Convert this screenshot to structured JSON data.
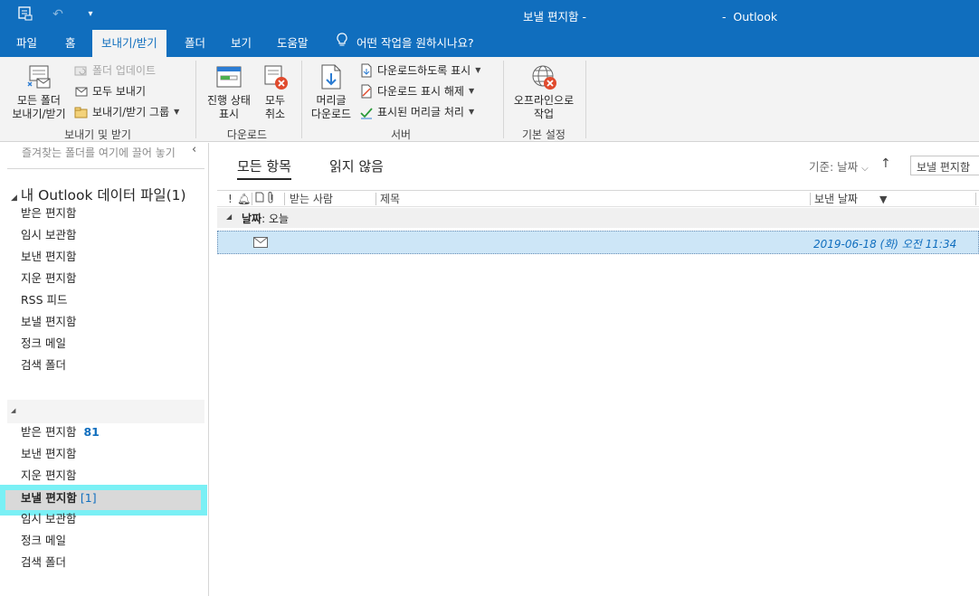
{
  "titlebar": {
    "title": "보낼 편지함 -",
    "app": "-  Outlook",
    "qat_icons": [
      "send-receive-all-icon",
      "undo-icon",
      "customize-qat-icon"
    ]
  },
  "tabs": [
    {
      "label": "파일"
    },
    {
      "label": "홈"
    },
    {
      "label": "보내기/받기",
      "active": true
    },
    {
      "label": "폴더"
    },
    {
      "label": "보기"
    },
    {
      "label": "도움말"
    }
  ],
  "tell_me": "어떤 작업을 원하시나요?",
  "ribbon": {
    "send_receive_all_line1": "모든 폴더",
    "send_receive_all_line2": "보내기/받기",
    "update_folder": "폴더 업데이트",
    "send_all": "모두 보내기",
    "send_receive_groups": "보내기/받기 그룹",
    "group1_label": "보내기 및 받기",
    "show_progress_line1": "진행 상태",
    "show_progress_line2": "표시",
    "cancel_all_line1": "모두",
    "cancel_all_line2": "취소",
    "group2_label": "다운로드",
    "download_headers_line1": "머리글",
    "download_headers_line2": "다운로드",
    "mark_to_download": "다운로드하도록 표시",
    "unmark_to_download": "다운로드 표시 해제",
    "process_marked_headers": "표시된 머리글 처리",
    "group3_label": "서버",
    "work_offline_line1": "오프라인으로",
    "work_offline_line2": "작업",
    "group4_label": "기본 설정"
  },
  "nav": {
    "favorites_hint": "즐겨찾는 폴더를 여기에 끌어 놓기",
    "store_name": "내 Outlook 데이터 파일(1)",
    "store_folders": [
      "받은 편지함",
      "임시 보관함",
      "보낸 편지함",
      "지운 편지함",
      "RSS 피드",
      "보낼 편지함",
      "정크 메일",
      "검색 폴더"
    ],
    "second_store": {
      "inbox": "받은 편지함",
      "inbox_count": "81",
      "sent": "보낸 편지함",
      "deleted": "지운 편지함",
      "outbox": "보낼 편지함",
      "outbox_count": "[1]",
      "drafts": "임시 보관함",
      "junk": "정크 메일",
      "search": "검색 폴더"
    }
  },
  "list": {
    "filter_all": "모든 항목",
    "filter_unread": "읽지 않음",
    "sort_by": "기준: 날짜",
    "search_placeholder": "보낼 편지함",
    "col_to": "받는 사람",
    "col_subject": "제목",
    "col_sent": "보낸 날짜",
    "group_prefix": "날짜",
    "group_value": ": 오늘",
    "rows": [
      {
        "to": "",
        "subject": "",
        "sent": "2019-06-18 (화) 오전 11:34"
      }
    ]
  },
  "colors": {
    "accent": "#106ebe",
    "selection_outline": "#7af0f5",
    "selected_row": "#cde6f7"
  }
}
